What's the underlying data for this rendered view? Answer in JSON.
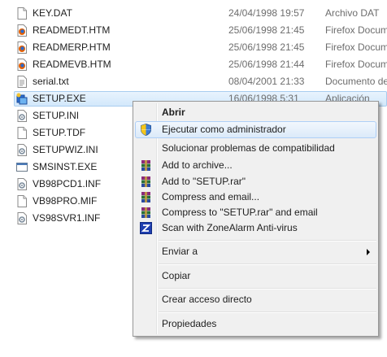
{
  "files": [
    {
      "name": "KEY.DAT",
      "date": "24/04/1998 19:57",
      "type": "Archivo DAT",
      "icon": "generic-file-icon"
    },
    {
      "name": "READMEDT.HTM",
      "date": "25/06/1998 21:45",
      "type": "Firefox Docum",
      "icon": "firefox-document-icon"
    },
    {
      "name": "READMERP.HTM",
      "date": "25/06/1998 21:45",
      "type": "Firefox Docum",
      "icon": "firefox-document-icon"
    },
    {
      "name": "READMEVB.HTM",
      "date": "25/06/1998 21:44",
      "type": "Firefox Docum",
      "icon": "firefox-document-icon"
    },
    {
      "name": "serial.txt",
      "date": "08/04/2001 21:33",
      "type": "Documento de",
      "icon": "text-file-icon"
    },
    {
      "name": "SETUP.EXE",
      "date": "16/06/1998 5:31",
      "type": "Aplicación",
      "icon": "setup-exe-icon"
    },
    {
      "name": "SETUP.INI",
      "date": "",
      "type": "",
      "icon": "ini-file-icon"
    },
    {
      "name": "SETUP.TDF",
      "date": "",
      "type": "",
      "icon": "generic-file-icon"
    },
    {
      "name": "SETUPWIZ.INI",
      "date": "",
      "type": "",
      "icon": "ini-file-icon"
    },
    {
      "name": "SMSINST.EXE",
      "date": "",
      "type": "",
      "icon": "exe-window-icon"
    },
    {
      "name": "VB98PCD1.INF",
      "date": "",
      "type": "",
      "icon": "inf-file-icon"
    },
    {
      "name": "VB98PRO.MIF",
      "date": "",
      "type": "",
      "icon": "generic-file-icon"
    },
    {
      "name": "VS98SVR1.INF",
      "date": "",
      "type": "",
      "icon": "inf-file-icon"
    }
  ],
  "selected_file": "SETUP.EXE",
  "context_menu": {
    "open": "Abrir",
    "run_as_admin": "Ejecutar como administrador",
    "troubleshoot": "Solucionar problemas de compatibilidad",
    "add_archive": "Add to archive...",
    "add_rar": "Add to \"SETUP.rar\"",
    "compress_email": "Compress and email...",
    "compress_rar_email": "Compress to \"SETUP.rar\" and email",
    "zonealarm": "Scan with ZoneAlarm Anti-virus",
    "send_to": "Enviar a",
    "copy": "Copiar",
    "create_shortcut": "Crear acceso directo",
    "properties": "Propiedades"
  },
  "colors": {
    "selection_bg": "#d3e8fb",
    "menu_bg": "#f0f0f0",
    "hover_border": "#aecff7"
  }
}
